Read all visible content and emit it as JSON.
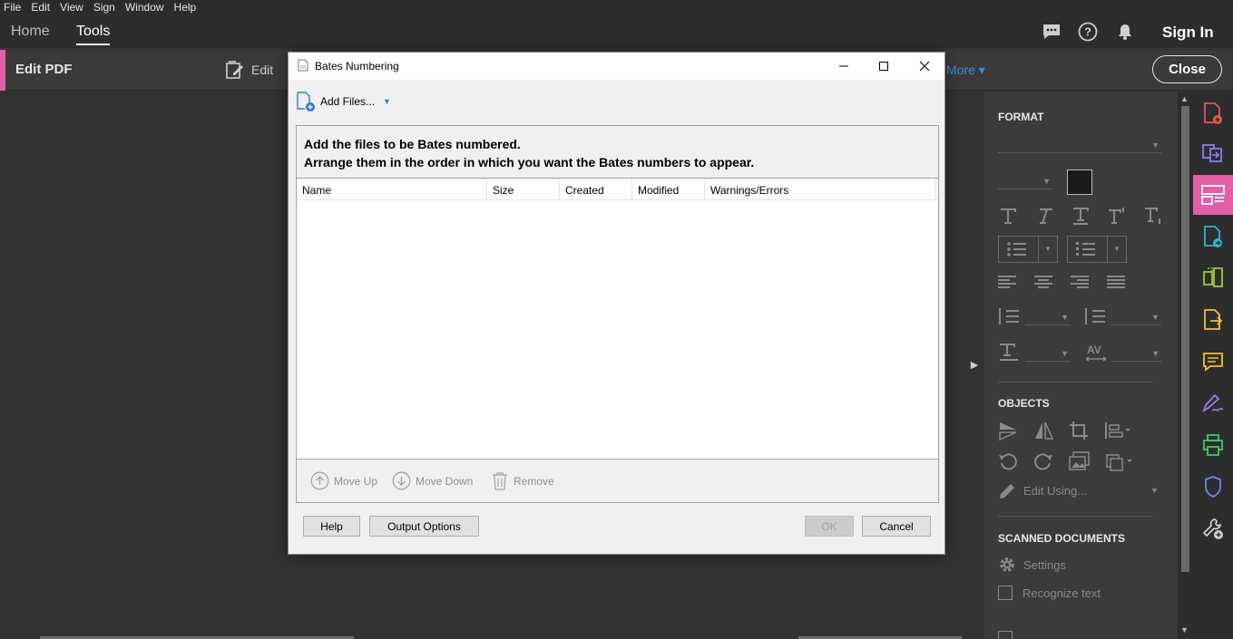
{
  "menubar": {
    "items": [
      "File",
      "Edit",
      "View",
      "Sign",
      "Window",
      "Help"
    ]
  },
  "nav": {
    "tabs": [
      {
        "label": "Home"
      },
      {
        "label": "Tools"
      }
    ],
    "icons": [
      "chat-icon",
      "help-icon",
      "bell-icon"
    ],
    "sign_in": "Sign In"
  },
  "toolbar": {
    "title": "Edit PDF",
    "edit_label": "Edit",
    "more_label": "More ▾",
    "close_label": "Close"
  },
  "format_panel": {
    "format_title": "FORMAT",
    "objects_title": "OBJECTS",
    "edit_using": "Edit Using...",
    "scanned_title": "SCANNED DOCUMENTS",
    "settings_label": "Settings",
    "recognize_label": "Recognize text",
    "text_color": "#1a1a1a"
  },
  "dialog": {
    "title": "Bates Numbering",
    "add_files": "Add Files...",
    "instructions": {
      "line1": "Add the files to be Bates numbered.",
      "line2": "Arrange them in the order in which you want the Bates numbers to appear."
    },
    "columns": [
      "Name",
      "Size",
      "Created",
      "Modified",
      "Warnings/Errors"
    ],
    "actions": {
      "move_up": "Move Up",
      "move_down": "Move Down",
      "remove": "Remove"
    },
    "buttons": {
      "help": "Help",
      "output_options": "Output Options",
      "ok": "OK",
      "cancel": "Cancel"
    }
  },
  "colors": {
    "accent": "#e25fa6",
    "link": "#3d8fdc"
  }
}
